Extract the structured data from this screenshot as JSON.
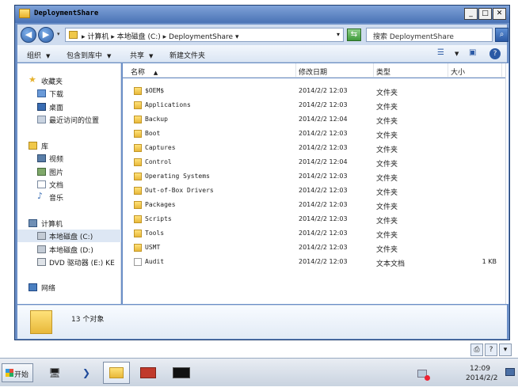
{
  "window": {
    "title": "DeploymentShare",
    "buttons": {
      "minimize": "_",
      "maximize": "□",
      "close": "✕"
    }
  },
  "address": {
    "path": "▸ 计算机 ▸ 本地磁盘 (C:) ▸ DeploymentShare ▾",
    "search_placeholder": "搜索 DeploymentShare"
  },
  "toolbar": {
    "organize": "组织",
    "include_in_library": "包含到库中",
    "share": "共享",
    "new_folder": "新建文件夹"
  },
  "nav": {
    "favorites": "收藏夹",
    "downloads": "下载",
    "desktop": "桌面",
    "recent": "最近访问的位置",
    "libraries": "库",
    "videos": "视频",
    "pictures": "图片",
    "documents": "文档",
    "music": "音乐",
    "computer": "计算机",
    "local_c": "本地磁盘 (C:)",
    "local_d": "本地磁盘 (D:)",
    "dvd": "DVD 驱动器 (E:) KE",
    "network": "网络"
  },
  "columns": {
    "name": "名称",
    "date": "修改日期",
    "type": "类型",
    "size": "大小"
  },
  "files": [
    {
      "name": "$OEM$",
      "date": "2014/2/2 12:03",
      "type": "文件夹",
      "size": ""
    },
    {
      "name": "Applications",
      "date": "2014/2/2 12:03",
      "type": "文件夹",
      "size": ""
    },
    {
      "name": "Backup",
      "date": "2014/2/2 12:04",
      "type": "文件夹",
      "size": ""
    },
    {
      "name": "Boot",
      "date": "2014/2/2 12:03",
      "type": "文件夹",
      "size": ""
    },
    {
      "name": "Captures",
      "date": "2014/2/2 12:03",
      "type": "文件夹",
      "size": ""
    },
    {
      "name": "Control",
      "date": "2014/2/2 12:04",
      "type": "文件夹",
      "size": ""
    },
    {
      "name": "Operating Systems",
      "date": "2014/2/2 12:03",
      "type": "文件夹",
      "size": ""
    },
    {
      "name": "Out-of-Box Drivers",
      "date": "2014/2/2 12:03",
      "type": "文件夹",
      "size": ""
    },
    {
      "name": "Packages",
      "date": "2014/2/2 12:03",
      "type": "文件夹",
      "size": ""
    },
    {
      "name": "Scripts",
      "date": "2014/2/2 12:03",
      "type": "文件夹",
      "size": ""
    },
    {
      "name": "Tools",
      "date": "2014/2/2 12:03",
      "type": "文件夹",
      "size": ""
    },
    {
      "name": "USMT",
      "date": "2014/2/2 12:03",
      "type": "文件夹",
      "size": ""
    },
    {
      "name": "Audit",
      "date": "2014/2/2 12:03",
      "type": "文本文档",
      "size": "1 KB"
    }
  ],
  "details": {
    "count": "13 个对象"
  },
  "taskbar": {
    "start": "开始",
    "clock_time": "12:09",
    "clock_date": "2014/2/2"
  },
  "colors": {
    "accent": "#2b5aa5",
    "folder": "#e8b83a"
  }
}
